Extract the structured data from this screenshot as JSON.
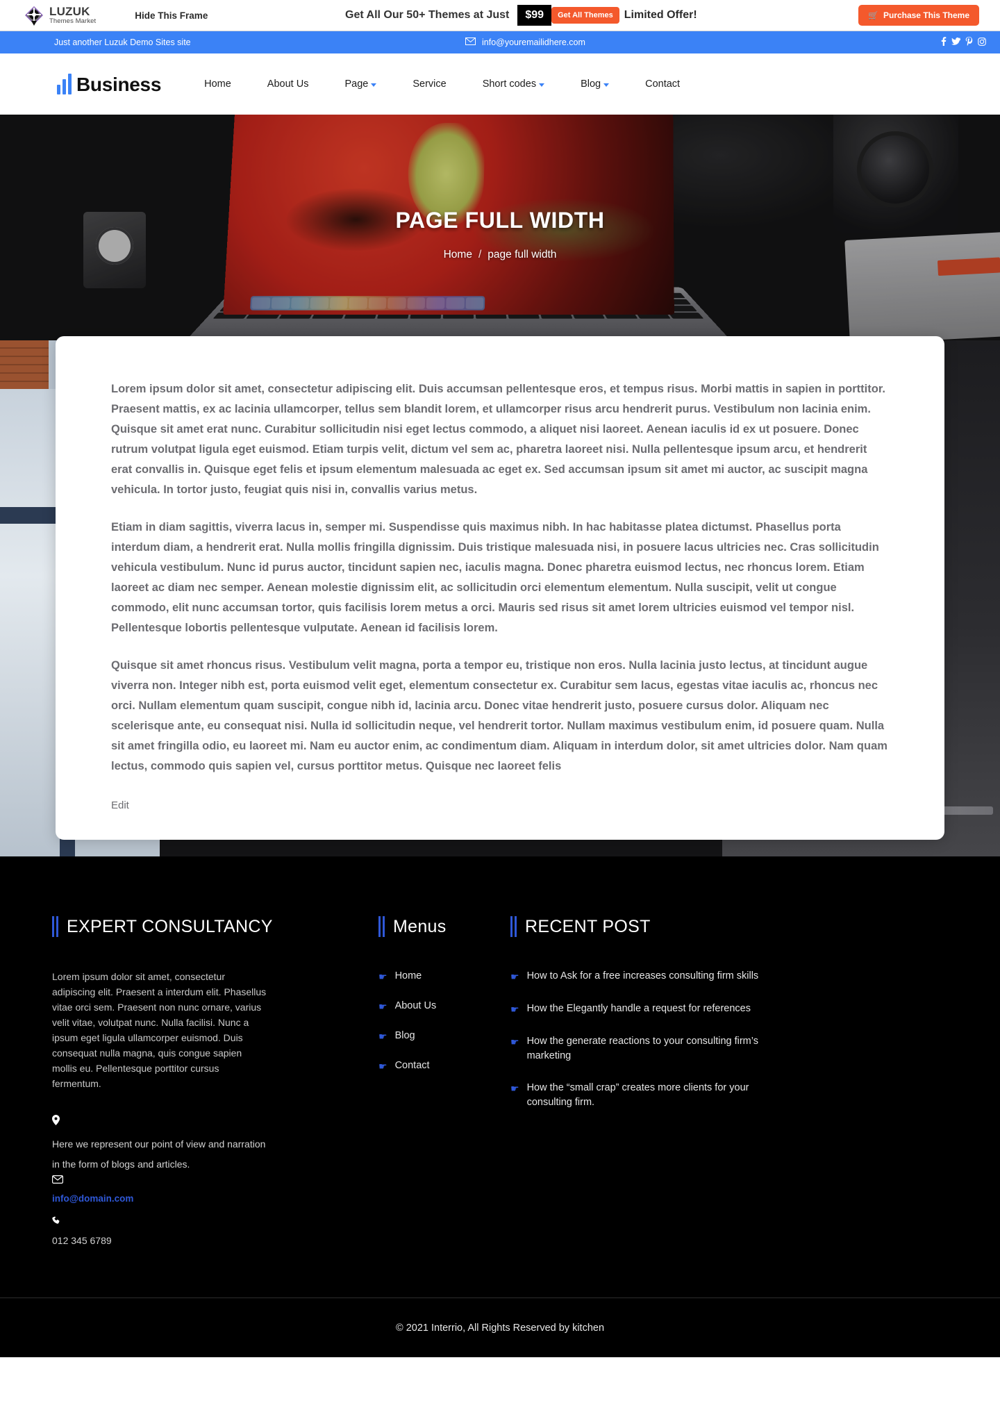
{
  "promo": {
    "brand_name": "LUZUK",
    "brand_sub": "Themes Market",
    "hide_frame": "Hide This Frame",
    "offer_text": "Get All Our 50+ Themes at Just",
    "price": "$99",
    "get_all_themes": "Get All Themes",
    "limited": "Limited Offer!",
    "purchase": "Purchase This Theme",
    "cart_icon": "cart-icon",
    "accent": "#f4592c"
  },
  "infobar": {
    "tagline": "Just another Luzuk Demo Sites site",
    "email": "info@youremailidhere.com",
    "mail_icon": "envelope-icon",
    "social": [
      "facebook-icon",
      "twitter-icon",
      "pinterest-icon",
      "instagram-icon"
    ],
    "social_glyphs": [
      "f",
      "✉",
      "ℙ",
      "▣"
    ],
    "bg": "#3b82f6"
  },
  "nav": {
    "brand": "Business",
    "items": [
      {
        "label": "Home",
        "caret": false
      },
      {
        "label": "About Us",
        "caret": false
      },
      {
        "label": "Page",
        "caret": true
      },
      {
        "label": "Service",
        "caret": false
      },
      {
        "label": "Short codes",
        "caret": true
      },
      {
        "label": "Blog",
        "caret": true
      },
      {
        "label": "Contact",
        "caret": false
      }
    ]
  },
  "hero": {
    "title": "PAGE FULL WIDTH",
    "crumb_home": "Home",
    "crumb_sep": "/",
    "crumb_current": "page full width"
  },
  "content": {
    "paragraphs": [
      "Lorem ipsum dolor sit amet, consectetur adipiscing elit. Duis accumsan pellentesque eros, et tempus risus. Morbi mattis in sapien in porttitor. Praesent mattis, ex ac lacinia ullamcorper, tellus sem blandit lorem, et ullamcorper risus arcu hendrerit purus. Vestibulum non lacinia enim. Quisque sit amet erat nunc. Curabitur sollicitudin nisi eget lectus commodo, a aliquet nisi laoreet. Aenean iaculis id ex ut posuere. Donec rutrum volutpat ligula eget euismod. Etiam turpis velit, dictum vel sem ac, pharetra laoreet nisi. Nulla pellentesque ipsum arcu, et hendrerit erat convallis in. Quisque eget felis et ipsum elementum malesuada ac eget ex. Sed accumsan ipsum sit amet mi auctor, ac suscipit magna vehicula. In tortor justo, feugiat quis nisi in, convallis varius metus.",
      "Etiam in diam sagittis, viverra lacus in, semper mi. Suspendisse quis maximus nibh. In hac habitasse platea dictumst. Phasellus porta interdum diam, a hendrerit erat. Nulla mollis fringilla dignissim. Duis tristique malesuada nisi, in posuere lacus ultricies nec. Cras sollicitudin vehicula vestibulum. Nunc id purus auctor, tincidunt sapien nec, iaculis magna. Donec pharetra euismod lectus, nec rhoncus lorem. Etiam laoreet ac diam nec semper. Aenean molestie dignissim elit, ac sollicitudin orci elementum elementum. Nulla suscipit, velit ut congue commodo, elit nunc accumsan tortor, quis facilisis lorem metus a orci. Mauris sed risus sit amet lorem ultricies euismod vel tempor nisl. Pellentesque lobortis pellentesque vulputate. Aenean id facilisis lorem.",
      "Quisque sit amet rhoncus risus. Vestibulum velit magna, porta a tempor eu, tristique non eros. Nulla lacinia justo lectus, at tincidunt augue viverra non. Integer nibh est, porta euismod velit eget, elementum consectetur ex. Curabitur sem lacus, egestas vitae iaculis ac, rhoncus nec orci. Nullam elementum quam suscipit, congue nibh id, lacinia arcu. Donec vitae hendrerit justo, posuere cursus dolor. Aliquam nec scelerisque ante, eu consequat nisi. Nulla id sollicitudin neque, vel hendrerit tortor. Nullam maximus vestibulum enim, id posuere quam. Nulla sit amet fringilla odio, eu laoreet mi. Nam eu auctor enim, ac condimentum diam. Aliquam in interdum dolor, sit amet ultricies dolor. Nam quam lectus, commodo quis sapien vel, cursus porttitor metus. Quisque nec laoreet felis"
    ],
    "edit": "Edit"
  },
  "footer": {
    "col1": {
      "title": "EXPERT CONSULTANCY",
      "body": "Lorem ipsum dolor sit amet, consectetur adipiscing elit. Praesent a interdum elit. Phasellus vitae orci sem. Praesent non nunc ornare, varius velit vitae, volutpat nunc. Nulla facilisi. Nunc a ipsum eget ligula ullamcorper euismod. Duis consequat nulla magna, quis congue sapien mollis eu. Pellentesque porttitor cursus fermentum.",
      "location_icon": "map-pin-icon",
      "address": "Here we represent our point of view and narration in the form of blogs and articles.",
      "mail_icon": "envelope-icon",
      "email": "info@domain.com",
      "phone_icon": "phone-icon",
      "phone": "012 345 6789"
    },
    "col2": {
      "title": "Menus",
      "items": [
        "Home",
        "About Us",
        "Blog",
        "Contact"
      ],
      "bullet_icon": "hand-point-right-icon"
    },
    "col3": {
      "title": "RECENT POST",
      "items": [
        "How to Ask for a free increases consulting firm skills",
        "How the Elegantly handle a request for references",
        "How the generate reactions to your consulting firm’s marketing",
        "How the “small crap” creates more clients for your consulting firm."
      ],
      "bullet_icon": "hand-point-right-icon"
    },
    "accent": "#2f58d8",
    "copyright": "© 2021 Interrio, All Rights Reserved by kitchen"
  }
}
